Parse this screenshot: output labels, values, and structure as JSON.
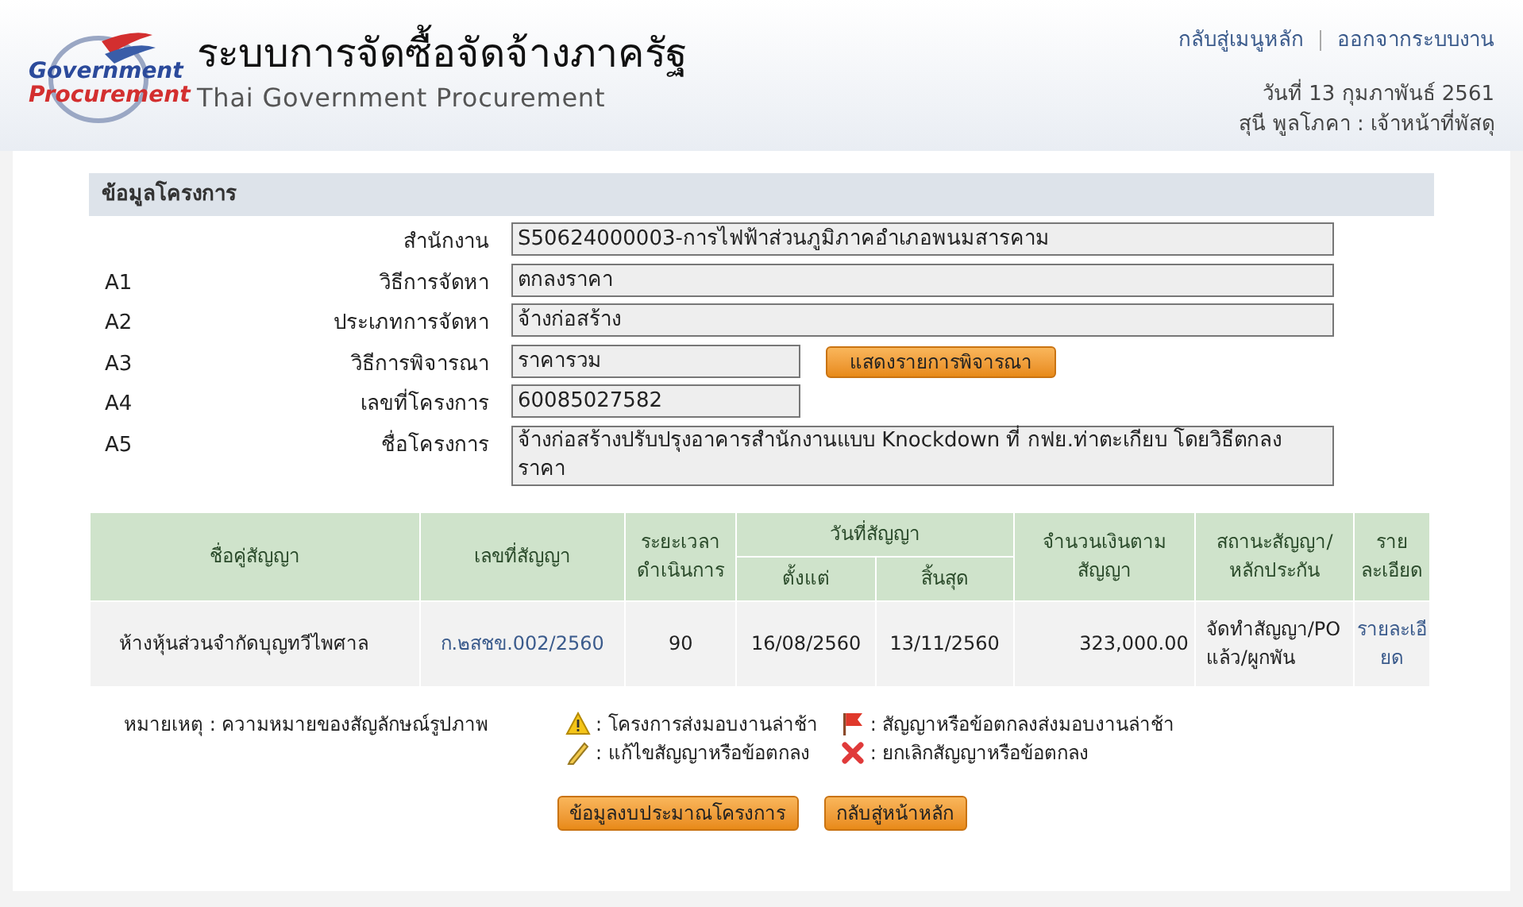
{
  "header": {
    "logo": {
      "line1": "Government",
      "line2": "Procurement"
    },
    "title": "ระบบการจัดซื้อจัดจ้างภาครัฐ",
    "subtitle": "Thai Government Procurement",
    "links": [
      "กลับสู่เมนูหลัก",
      "ออกจากระบบงาน"
    ],
    "date": "วันที่ 13 กุมภาพันธ์ 2561",
    "user": "สุนี พูลโภคา : เจ้าหน้าที่พัสดุ"
  },
  "project": {
    "title": "ข้อมูลโครงการ",
    "fields": [
      {
        "label": "สำนักงาน",
        "value": "S50624000003-การไฟฟ้าส่วนภูมิภาคอำเภอพนมสารคาม",
        "kind": "wide"
      },
      {
        "code": "A1",
        "label": "วิธีการจัดหา",
        "value": "ตกลงราคา",
        "kind": "wide"
      },
      {
        "code": "A2",
        "label": "ประเภทการจัดหา",
        "value": "จ้างก่อสร้าง",
        "kind": "wide"
      },
      {
        "code": "A3",
        "label": "วิธีการพิจารณา",
        "value": "ราคารวม",
        "kind": "short",
        "button": "แสดงรายการพิจารณา"
      },
      {
        "code": "A4",
        "label": "เลขที่โครงการ",
        "value": "60085027582",
        "kind": "short"
      },
      {
        "code": "A5",
        "label": "ชื่อโครงการ",
        "value": "จ้างก่อสร้างปรับปรุงอาคารสำนักงานแบบ Knockdown ที่ กฟย.ท่าตะเกียบ โดยวิธีตกลงราคา",
        "kind": "textarea"
      }
    ]
  },
  "table": {
    "header_rows": [
      [
        {
          "label": "ชื่อคู่สัญญา",
          "rowspan": 2
        },
        {
          "label": "เลขที่สัญญา",
          "rowspan": 2
        },
        {
          "label": "ระยะเวลาดำเนินการ",
          "rowspan": 2
        },
        {
          "label": "วันที่สัญญา",
          "colspan": 2
        },
        {
          "label": "จำนวนเงินตามสัญญา",
          "rowspan": 2
        },
        {
          "label": "สถานะสัญญา/หลักประกัน",
          "rowspan": 2
        },
        {
          "label": "รายละเอียด",
          "rowspan": 2
        }
      ],
      [
        {
          "label": "ตั้งแต่"
        },
        {
          "label": "สิ้นสุด"
        }
      ]
    ],
    "rows": [
      {
        "cells": [
          {
            "kind": "text",
            "text": "ห้างหุ้นส่วนจำกัดบุญทวีไพศาล"
          },
          {
            "kind": "link",
            "text": "ก.๒สชข.002/2560"
          },
          {
            "kind": "center",
            "text": "90"
          },
          {
            "kind": "center",
            "text": "16/08/2560"
          },
          {
            "kind": "center",
            "text": "13/11/2560"
          },
          {
            "kind": "right",
            "text": "323,000.00"
          },
          {
            "kind": "text",
            "text": "จัดทำสัญญา/PO แล้ว/ผูกพัน"
          },
          {
            "kind": "link",
            "text": "รายละเอียด"
          }
        ]
      }
    ]
  },
  "legend": {
    "label": "หมายเหตุ : ความหมายของสัญลักษณ์รูปภาพ",
    "items": [
      {
        "kind": "warning",
        "text": ": โครงการส่งมอบงานล่าช้า"
      },
      {
        "kind": "flag",
        "text": ": สัญญาหรือข้อตกลงส่งมอบงานล่าช้า"
      },
      {
        "kind": "pencil",
        "text": ": แก้ไขสัญญาหรือข้อตกลง"
      },
      {
        "kind": "cross",
        "text": ": ยกเลิกสัญญาหรือข้อตกลง"
      }
    ]
  },
  "buttons": [
    "ข้อมูลงบประมาณโครงการ",
    "กลับสู่หน้าหลัก"
  ]
}
